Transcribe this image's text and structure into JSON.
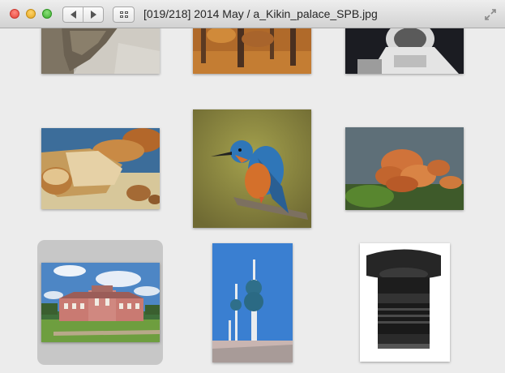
{
  "window": {
    "title": "[019/218] 2014 May / a_Kikin_palace_SPB.jpg"
  },
  "toolbar": {
    "icons": [
      "back-arrow-icon",
      "forward-arrow-icon",
      "grid-view-icon",
      "fullscreen-icon"
    ]
  },
  "thumbnails": [
    {
      "subject": "lizard-on-rock",
      "selected": false
    },
    {
      "subject": "autumn-forest",
      "selected": false
    },
    {
      "subject": "astronaut",
      "selected": false
    },
    {
      "subject": "bread-loaves",
      "selected": false
    },
    {
      "subject": "kingfisher-bird",
      "selected": false
    },
    {
      "subject": "orange-fungus",
      "selected": false
    },
    {
      "subject": "kikin-palace",
      "selected": true
    },
    {
      "subject": "kuwait-towers",
      "selected": false
    },
    {
      "subject": "camera-lens",
      "selected": false
    }
  ],
  "colors": {
    "background": "#ececec",
    "selection": "#c7c7c7",
    "close": "#e5453b",
    "minimize": "#e3a722",
    "zoom": "#3cae2f"
  }
}
